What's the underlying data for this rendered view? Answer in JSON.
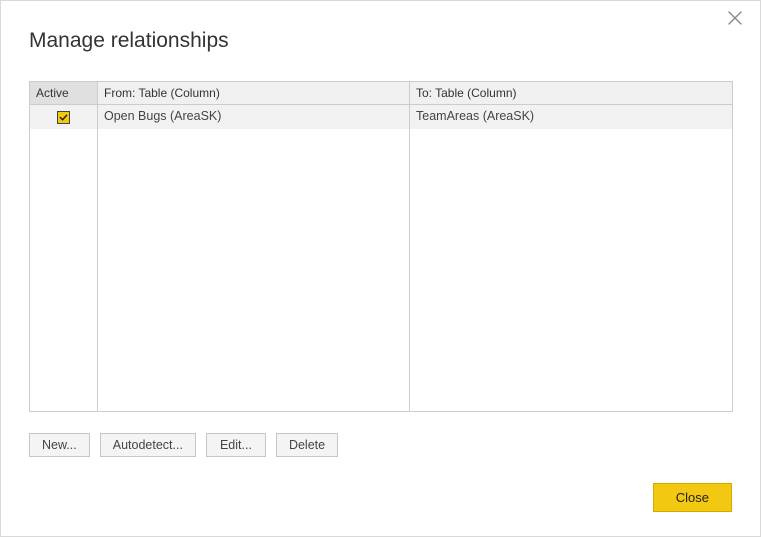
{
  "dialog": {
    "title": "Manage relationships"
  },
  "table": {
    "headers": {
      "active": "Active",
      "from": "From: Table (Column)",
      "to": "To: Table (Column)"
    },
    "rows": [
      {
        "active": true,
        "from": "Open Bugs (AreaSK)",
        "to": "TeamAreas (AreaSK)"
      }
    ]
  },
  "buttons": {
    "new": "New...",
    "autodetect": "Autodetect...",
    "edit": "Edit...",
    "delete": "Delete",
    "close": "Close"
  }
}
